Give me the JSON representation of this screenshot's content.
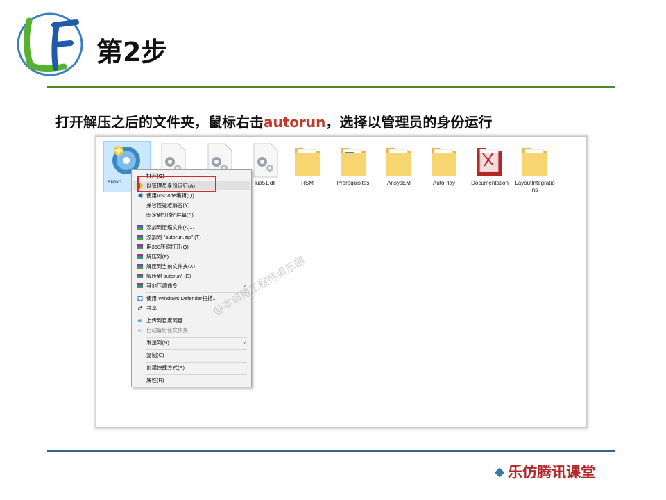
{
  "slide": {
    "step_title": "第2步",
    "instruction_before": "打开解压之后的文件夹，鼠标右击",
    "instruction_highlight": "autorun",
    "instruction_after": "，选择以管理员的身份运行",
    "logo_icon": "lf-logo-icon",
    "brand": "乐仿腾讯课堂",
    "brand_icon": "diamond-cluster-icon",
    "watermark": "@本领博工程师俱乐部",
    "colors": {
      "accent_green": "#4a8a2a",
      "accent_blue": "#3a5f8a",
      "highlight_red": "#d42a2a",
      "brand_red": "#b0282a"
    }
  },
  "explorer": {
    "files": [
      {
        "label": "autorun",
        "icon": "setup-cd-icon"
      },
      {
        "label": "",
        "icon": "settings-file-icon"
      },
      {
        "label": "",
        "icon": "settings-file-icon"
      },
      {
        "label": "lua51.dll",
        "icon": "dll-file-icon"
      },
      {
        "label": "RSM",
        "icon": "folder-icon"
      },
      {
        "label": "Prerequisites",
        "icon": "folder-icon"
      },
      {
        "label": "AnsysEM",
        "icon": "folder-icon"
      },
      {
        "label": "AutoPlay",
        "icon": "folder-icon"
      },
      {
        "label": "Documentation",
        "icon": "pdf-folder-icon"
      },
      {
        "label": "LayoutIntegrations",
        "icon": "folder-icon"
      }
    ],
    "autorun_visible_label": "autori",
    "dll_visible_label": "lua51.dll"
  },
  "context_menu": {
    "items": [
      {
        "label": "打开(O)",
        "bold": true
      },
      {
        "label": "以管理员身份运行(A)",
        "icon": "uac-shield-icon"
      },
      {
        "label": "使用VSCode编辑(Q)",
        "icon": "vscode-icon"
      },
      {
        "label": "兼容性疑难解答(Y)"
      },
      {
        "label": "固定到\"开始\"屏幕(P)"
      },
      {
        "label": "添加到压缩文件(A)...",
        "icon": "winrar-icon"
      },
      {
        "label": "添加到 \"autorun.zip\" (T)",
        "icon": "winrar-icon"
      },
      {
        "label": "用360压缩打开(Q)",
        "icon": "winrar-icon"
      },
      {
        "label": "解压到(F)...",
        "icon": "winrar-icon"
      },
      {
        "label": "解压到当前文件夹(X)",
        "icon": "winrar-icon"
      },
      {
        "label": "解压到 autorun\\ (E)",
        "icon": "winrar-icon"
      },
      {
        "label": "其他压缩命令",
        "icon": "winrar-icon",
        "submenu": true
      },
      {
        "label": "使用 Windows Defender扫描...",
        "icon": "defender-icon"
      },
      {
        "label": "共享",
        "icon": "share-icon"
      },
      {
        "label": "上传到百度网盘",
        "icon": "baidu-cloud-icon"
      },
      {
        "label": "自动备份该文件夹",
        "icon": "baidu-cloud-icon",
        "disabled": true
      },
      {
        "label": "发送到(N)",
        "submenu": true
      },
      {
        "label": "复制(C)"
      },
      {
        "label": "创建快捷方式(S)"
      },
      {
        "label": "属性(R)"
      }
    ]
  }
}
